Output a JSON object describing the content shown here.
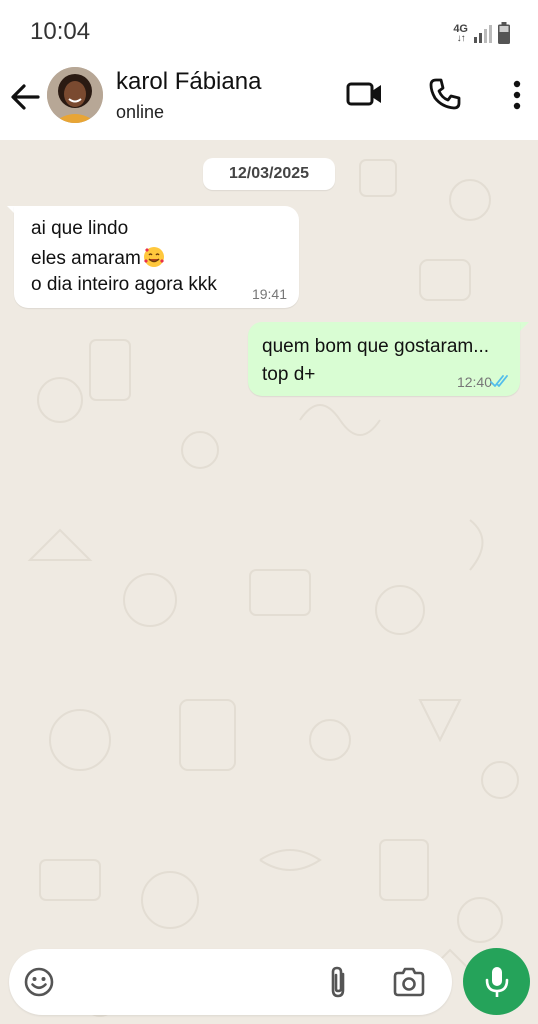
{
  "status_bar": {
    "time": "10:04",
    "network": "4G",
    "icons": [
      "network-4g-icon",
      "signal-icon",
      "battery-icon"
    ]
  },
  "header": {
    "contact_name": "karol Fábiana",
    "contact_status": "online",
    "icons": [
      "back-arrow-icon",
      "avatar",
      "video-call-icon",
      "phone-call-icon",
      "more-options-icon"
    ]
  },
  "chat": {
    "date_chip": "12/03/2025",
    "messages": [
      {
        "direction": "incoming",
        "lines": [
          "ai que lindo",
          "eles amaram",
          "o dia inteiro agora kkk"
        ],
        "emoji": "smiling-face-with-hearts",
        "time": "19:41"
      },
      {
        "direction": "outgoing",
        "lines": [
          "quem bom que gostaram...",
          "top d+"
        ],
        "time": "12:40",
        "status": "read"
      }
    ]
  },
  "input_bar": {
    "placeholder": "",
    "icons": [
      "emoji-icon",
      "attach-icon",
      "camera-icon",
      "mic-icon"
    ]
  },
  "colors": {
    "chat_background": "#efeae2",
    "incoming_bubble": "#ffffff",
    "outgoing_bubble": "#d9fdd3",
    "accent_green": "#25a35a",
    "read_ticks": "#53bdeb"
  }
}
